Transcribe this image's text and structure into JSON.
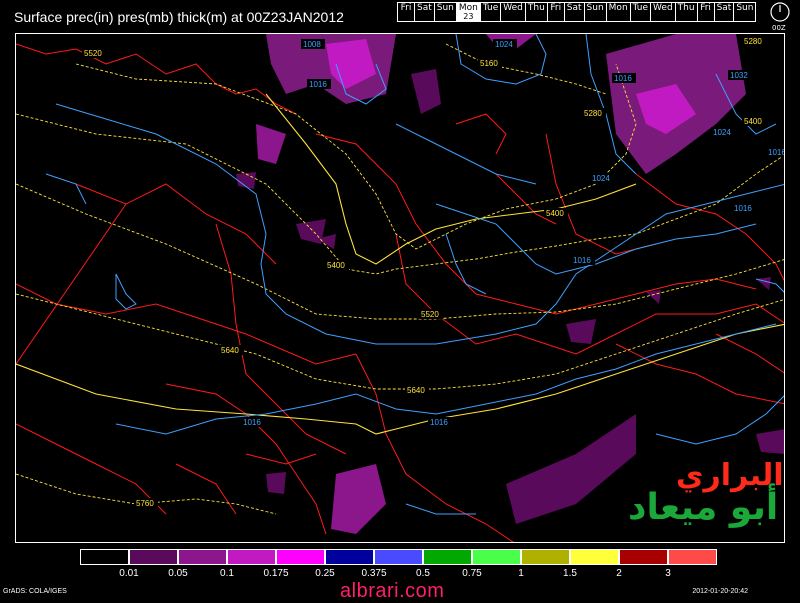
{
  "header": {
    "title": "Surface prec(in) pres(mb) thick(m) at 00Z23JAN2012",
    "days": [
      {
        "label": "Fri"
      },
      {
        "label": "Sat"
      },
      {
        "label": "Sun"
      },
      {
        "label": "Mon",
        "sub": "23",
        "active": true
      },
      {
        "label": "Tue"
      },
      {
        "label": "Wed"
      },
      {
        "label": "Thu"
      },
      {
        "label": "Fri"
      },
      {
        "label": "Sat"
      },
      {
        "label": "Sun"
      },
      {
        "label": "Mon"
      },
      {
        "label": "Tue"
      },
      {
        "label": "Wed"
      },
      {
        "label": "Thu"
      },
      {
        "label": "Fri"
      },
      {
        "label": "Sat"
      },
      {
        "label": "Sun"
      }
    ],
    "clock_label": "00Z"
  },
  "map": {
    "pressure_labels": [
      "1008",
      "1016",
      "1024",
      "1016",
      "1024",
      "1032",
      "1024",
      "1016",
      "1016",
      "1016",
      "1016",
      "1016"
    ],
    "thickness_labels": [
      "5520",
      "5160",
      "5280",
      "5280",
      "5400",
      "5400",
      "5400",
      "5520",
      "5640",
      "5640",
      "5760"
    ],
    "colors": {
      "pressure": "#3fa0ff",
      "thickness": "#ffe23a",
      "boundaries": "#ff1a1a"
    }
  },
  "legend": {
    "colors": [
      "#000000",
      "#5a0a5a",
      "#8c178c",
      "#c21ac2",
      "#ff00ff",
      "#00009c",
      "#4a4aff",
      "#00a800",
      "#4aff4a",
      "#b0b000",
      "#ffff3a",
      "#a80000",
      "#ff4a4a"
    ],
    "labels": [
      "0.01",
      "0.05",
      "0.1",
      "0.175",
      "0.25",
      "0.375",
      "0.5",
      "0.75",
      "1",
      "1.5",
      "2",
      "3"
    ]
  },
  "footer": {
    "left": "GrADS: COLA/IGES",
    "right": "2012-01-20-20:42",
    "site": "albrari.com",
    "brand_top": "البراري",
    "brand_bottom": "أبو ميعاد"
  }
}
